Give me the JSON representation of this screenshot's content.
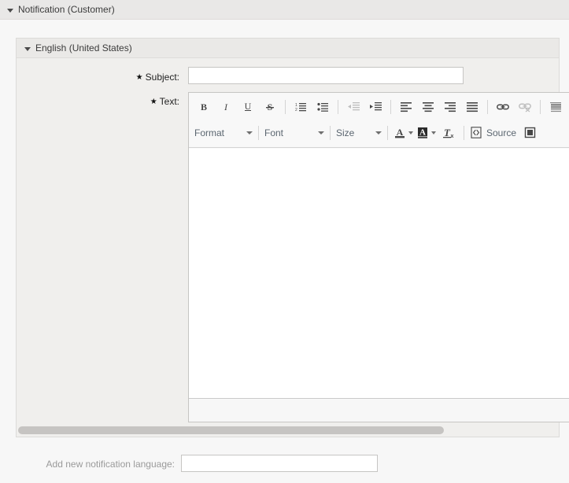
{
  "widget": {
    "title": "Notification (Customer)",
    "collapse_icon": "caret-down-icon"
  },
  "language_panel": {
    "title": "English (United States)",
    "collapse_icon": "caret-down-icon",
    "fields": {
      "subject": {
        "label": "Subject:",
        "required_marker": "★",
        "value": "",
        "placeholder": ""
      },
      "text": {
        "label": "Text:",
        "required_marker": "★",
        "value": "",
        "placeholder": ""
      }
    }
  },
  "editor": {
    "toolbar_row_1": [
      {
        "name": "bold-icon",
        "label": "B",
        "disabled": false
      },
      {
        "name": "italic-icon",
        "label": "I",
        "disabled": false
      },
      {
        "name": "underline-icon",
        "label": "U",
        "disabled": false
      },
      {
        "name": "strikethrough-icon",
        "label": "S",
        "disabled": false
      },
      {
        "name": "numbered-list-icon",
        "label": "",
        "disabled": false
      },
      {
        "name": "bulleted-list-icon",
        "label": "",
        "disabled": false
      },
      {
        "name": "decrease-indent-icon",
        "label": "",
        "disabled": true
      },
      {
        "name": "increase-indent-icon",
        "label": "",
        "disabled": false
      },
      {
        "name": "align-left-icon",
        "label": "",
        "disabled": false
      },
      {
        "name": "align-center-icon",
        "label": "",
        "disabled": false
      },
      {
        "name": "align-right-icon",
        "label": "",
        "disabled": false
      },
      {
        "name": "align-justify-icon",
        "label": "",
        "disabled": false
      },
      {
        "name": "link-icon",
        "label": "",
        "disabled": false
      },
      {
        "name": "unlink-icon",
        "label": "",
        "disabled": true
      },
      {
        "name": "blockquote-icon",
        "label": "",
        "disabled": false
      }
    ],
    "toolbar_row_2": {
      "format_combo": "Format",
      "font_combo": "Font",
      "size_combo": "Size",
      "text_color": "text-color-icon",
      "background_color": "background-color-icon",
      "remove_format": "remove-format-icon",
      "source_button": "Source",
      "source_icon": "source-code-icon",
      "maximize_icon": "maximize-icon"
    },
    "content": "",
    "footer_path": ""
  },
  "scrollbar": {
    "orientation": "horizontal",
    "thumb_position_percent": 0
  },
  "footer": {
    "add_language_label": "Add new notification language:",
    "add_language_value": "",
    "add_language_placeholder": ""
  },
  "colors": {
    "page_background": "#f7f7f7",
    "panel_background": "#f0efed",
    "header_background": "#e9e8e7",
    "border": "#dcdbd9",
    "input_border": "#c6c5c3",
    "toolbar_text": "#5b6670",
    "label_text": "#1f1f1f",
    "muted_text": "#9a9a9a",
    "scrollbar_thumb": "#c6c4c2"
  }
}
